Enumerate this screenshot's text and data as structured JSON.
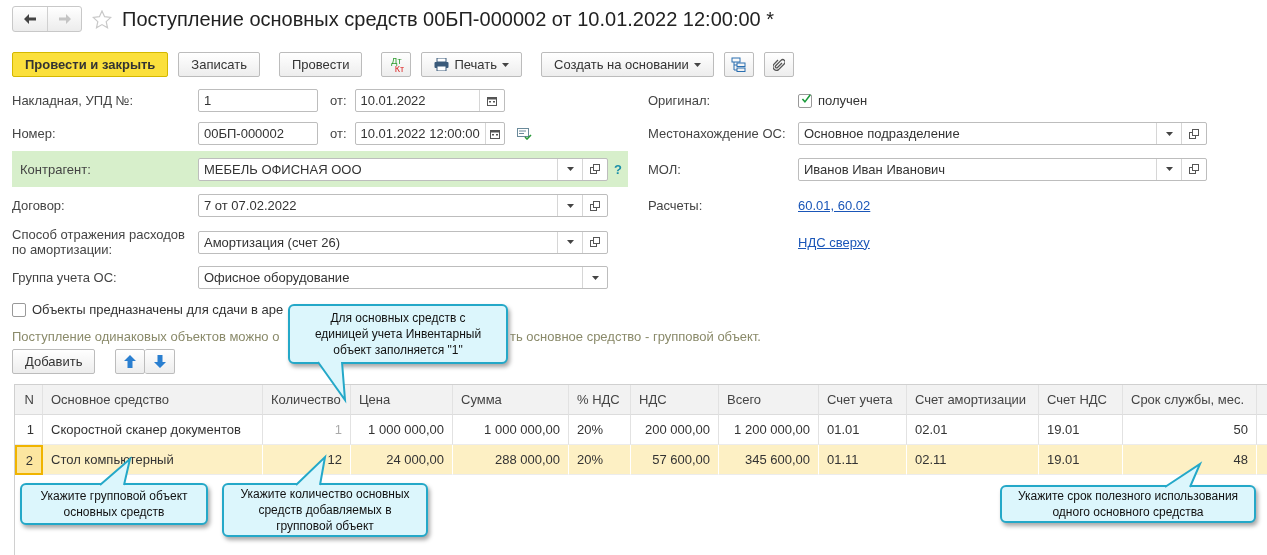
{
  "window": {
    "title": "Поступление основных средств 00БП-000002 от 10.01.2022 12:00:00 *",
    "forward_disabled": true
  },
  "toolbar": [
    {
      "kind": "primary",
      "label": "Провести и закрыть"
    },
    {
      "kind": "button",
      "label": "Записать"
    },
    {
      "kind": "button",
      "label": "Провести"
    },
    {
      "kind": "dtkt",
      "top": "Дт",
      "bottom": "Кт"
    },
    {
      "kind": "print",
      "label": "Печать"
    },
    {
      "kind": "menu",
      "label": "Создать на основании"
    },
    {
      "kind": "icon"
    },
    {
      "kind": "icon"
    }
  ],
  "left": [
    {
      "kind": "number_date",
      "label": "Накладная, УПД №:",
      "value": "1",
      "from_label": "от:",
      "date": "10.01.2022",
      "highlighted": false
    },
    {
      "kind": "number_date",
      "label": "Номер:",
      "value": "00БП-000002",
      "from_label": "от:",
      "date": "10.01.2022 12:00:00",
      "highlighted": false,
      "status_icon": true
    },
    {
      "kind": "select",
      "label": "Контрагент:",
      "value": "МЕБЕЛЬ ОФИСНАЯ ООО",
      "open_button": true,
      "highlighted": true,
      "help": "?"
    },
    {
      "kind": "select",
      "label": "Договор:",
      "value": "7 от 07.02.2022",
      "open_button": true,
      "highlighted": false
    },
    {
      "kind": "select",
      "label": "Способ отражения расходов по амортизации:",
      "value": "Амортизация (счет 26)",
      "open_button": true,
      "highlighted": false
    },
    {
      "kind": "select",
      "label": "Группа учета ОС:",
      "value": "Офисное оборудование",
      "open_button": false,
      "highlighted": false
    }
  ],
  "right": [
    {
      "kind": "checkbox",
      "label": "Оригинал:",
      "text": "получен",
      "checked": true
    },
    {
      "kind": "select",
      "label": "Местонахождение ОС:",
      "value": "Основное подразделение",
      "open_button": true
    },
    {
      "kind": "select",
      "label": "МОЛ:",
      "value": "Иванов Иван Иванович",
      "open_button": true
    },
    {
      "kind": "link",
      "label": "Расчеты:",
      "text": "60.01, 60.02"
    },
    {
      "kind": "link",
      "text": "НДС сверху"
    }
  ],
  "lease_checkbox": {
    "text": "Объекты предназначены для сдачи в аре",
    "checked": false
  },
  "hint": {
    "before": "Поступление одинаковых объектов можно о",
    "after": "ть основное средство - групповой объект."
  },
  "table_toolbar": {
    "add": "Добавить"
  },
  "table": {
    "columns": [
      {
        "label": "N"
      },
      {
        "label": "Основное средство"
      },
      {
        "label": "Количество"
      },
      {
        "label": "Цена"
      },
      {
        "label": "Сумма"
      },
      {
        "label": "% НДС"
      },
      {
        "label": "НДС"
      },
      {
        "label": "Всего"
      },
      {
        "label": "Счет учета"
      },
      {
        "label": "Счет амортизации"
      },
      {
        "label": "Счет НДС"
      },
      {
        "label": "Срок службы, мес."
      }
    ],
    "rows": [
      {
        "selected": false,
        "quantity_locked": true,
        "cells": [
          "1",
          "Скоростной сканер документов",
          "1",
          "1 000 000,00",
          "1 000 000,00",
          "20%",
          "200 000,00",
          "1 200 000,00",
          "01.01",
          "02.01",
          "19.01",
          "50"
        ]
      },
      {
        "selected": true,
        "quantity_locked": false,
        "cells": [
          "2",
          "Стол компьютерный",
          "12",
          "24 000,00",
          "288 000,00",
          "20%",
          "57 600,00",
          "345 600,00",
          "01.11",
          "02.11",
          "19.01",
          "48"
        ]
      }
    ]
  },
  "callouts": [
    {
      "text": "Для основных средств с единицей учета Инвентарный объект заполняется \"1\""
    },
    {
      "text": "Укажите групповой объект основных средств"
    },
    {
      "text": "Укажите количество основных средств добавляемых в групповой объект"
    },
    {
      "text": "Укажите срок полезного использования одного основного средства"
    }
  ]
}
